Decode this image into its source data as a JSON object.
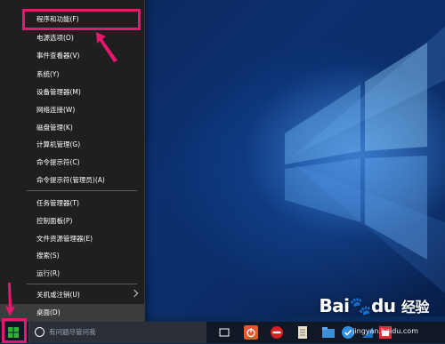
{
  "menu": {
    "items": [
      {
        "label": "程序和功能(F)"
      },
      {
        "label": "电源选项(O)"
      },
      {
        "label": "事件查看器(V)"
      },
      {
        "label": "系统(Y)"
      },
      {
        "label": "设备管理器(M)"
      },
      {
        "label": "网络连接(W)"
      },
      {
        "label": "磁盘管理(K)"
      },
      {
        "label": "计算机管理(G)"
      },
      {
        "label": "命令提示符(C)"
      },
      {
        "label": "命令提示符(管理员)(A)"
      },
      {
        "label": "任务管理器(T)"
      },
      {
        "label": "控制面板(P)"
      },
      {
        "label": "文件资源管理器(E)"
      },
      {
        "label": "搜索(S)"
      },
      {
        "label": "运行(R)"
      },
      {
        "label": "关机或注销(U)"
      },
      {
        "label": "桌面(D)"
      }
    ]
  },
  "taskbar": {
    "search_placeholder": "有问题尽管问我"
  },
  "watermark": {
    "brand": "Bai",
    "brand_mid": "du",
    "brand_suffix": "经验",
    "sub": "jingyan.baidu.com"
  },
  "colors": {
    "annotation": "#e8186f",
    "menu_bg": "#1f1f1f",
    "taskbar_bg": "#101725",
    "start_icon": "#2fb336"
  }
}
